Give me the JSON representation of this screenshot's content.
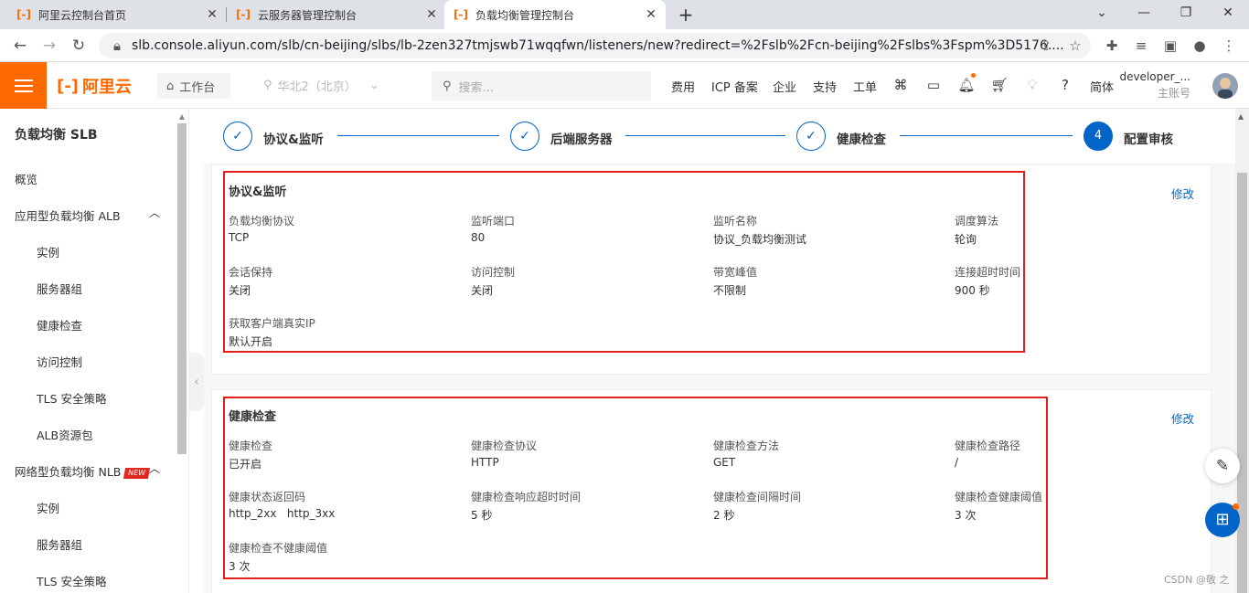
{
  "browser": {
    "tabs": [
      {
        "title": "阿里云控制台首页",
        "active": false
      },
      {
        "title": "云服务器管理控制台",
        "active": false
      },
      {
        "title": "负载均衡管理控制台",
        "active": true
      }
    ],
    "url": "slb.console.aliyun.com/slb/cn-beijing/slbs/lb-2zen327tmjswb71wqqfwn/listeners/new?redirect=%2Fslb%2Fcn-beijing%2Fslbs%3Fspm%3D5176...."
  },
  "header": {
    "logo": "阿里云",
    "workbench": "工作台",
    "region": "华北2（北京）",
    "search_placeholder": "搜索...",
    "nav": [
      "费用",
      "ICP 备案",
      "企业",
      "支持",
      "工单"
    ],
    "lang": "简体",
    "user_name": "developer_...",
    "user_role": "主账号"
  },
  "sidebar": {
    "title": "负载均衡 SLB",
    "items": [
      {
        "label": "概览"
      },
      {
        "label": "应用型负载均衡 ALB"
      },
      {
        "label": "实例"
      },
      {
        "label": "服务器组"
      },
      {
        "label": "健康检查"
      },
      {
        "label": "访问控制"
      },
      {
        "label": "TLS 安全策略"
      },
      {
        "label": "ALB资源包"
      },
      {
        "label": "网络型负载均衡 NLB",
        "badge": "NEW"
      },
      {
        "label": "实例"
      },
      {
        "label": "服务器组"
      },
      {
        "label": "TLS 安全策略"
      }
    ]
  },
  "steps": [
    {
      "label": "协议&监听",
      "state": "done"
    },
    {
      "label": "后端服务器",
      "state": "done"
    },
    {
      "label": "健康检查",
      "state": "done"
    },
    {
      "label": "配置审核",
      "state": "current",
      "number": "4"
    }
  ],
  "sections": [
    {
      "title": "协议&监听",
      "edit": "修改",
      "fields": [
        {
          "label": "负载均衡协议",
          "value": "TCP"
        },
        {
          "label": "监听端口",
          "value": "80"
        },
        {
          "label": "监听名称",
          "value": "协议_负载均衡测试"
        },
        {
          "label": "调度算法",
          "value": "轮询"
        },
        {
          "label": "会话保持",
          "value": "关闭"
        },
        {
          "label": "访问控制",
          "value": "关闭"
        },
        {
          "label": "带宽峰值",
          "value": "不限制"
        },
        {
          "label": "连接超时时间",
          "value": "900 秒"
        },
        {
          "label": "获取客户端真实IP",
          "value": "默认开启"
        }
      ]
    },
    {
      "title": "健康检查",
      "edit": "修改",
      "fields": [
        {
          "label": "健康检查",
          "value": "已开启"
        },
        {
          "label": "健康检查协议",
          "value": "HTTP"
        },
        {
          "label": "健康检查方法",
          "value": "GET"
        },
        {
          "label": "健康检查路径",
          "value": "/"
        },
        {
          "label": "健康状态返回码",
          "value": "http_2xx   http_3xx"
        },
        {
          "label": "健康检查响应超时时间",
          "value": "5 秒"
        },
        {
          "label": "健康检查间隔时间",
          "value": "2 秒"
        },
        {
          "label": "健康检查健康阈值",
          "value": "3 次"
        },
        {
          "label": "健康检查不健康阈值",
          "value": "3 次"
        }
      ]
    }
  ],
  "watermark": "CSDN @敬 之",
  "colors": {
    "brand": "#ff6a00",
    "primary": "#0064c8",
    "highlight": "#e0201b"
  }
}
